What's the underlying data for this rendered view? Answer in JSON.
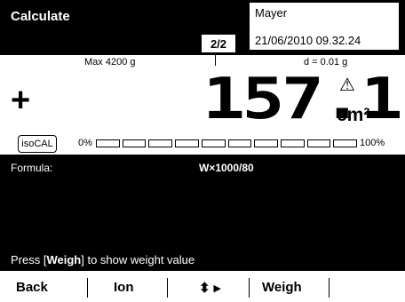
{
  "header": {
    "title": "Calculate",
    "page_indicator": "2/2",
    "user": "Mayer",
    "datetime": "21/06/2010 09.32.24"
  },
  "weighing": {
    "max_label": "Max 4200 g",
    "d_label": "d = 0.01 g",
    "sign": "+",
    "value": "157.1",
    "unit": "cm²",
    "warning_symbol": "⚠",
    "isocal_label": "isoCAL",
    "range_min_label": "0%",
    "range_max_label": "100%",
    "range_fill_fraction": 0
  },
  "info": {
    "formula_label": "Formula:",
    "formula": "W×1000/80",
    "hint_prefix": "Press [",
    "hint_key": "Weigh",
    "hint_suffix": "] to show weight value"
  },
  "softkeys": {
    "back": "Back",
    "ion": "Ion",
    "nav": "⬍ ▸",
    "weigh": "Weigh"
  }
}
